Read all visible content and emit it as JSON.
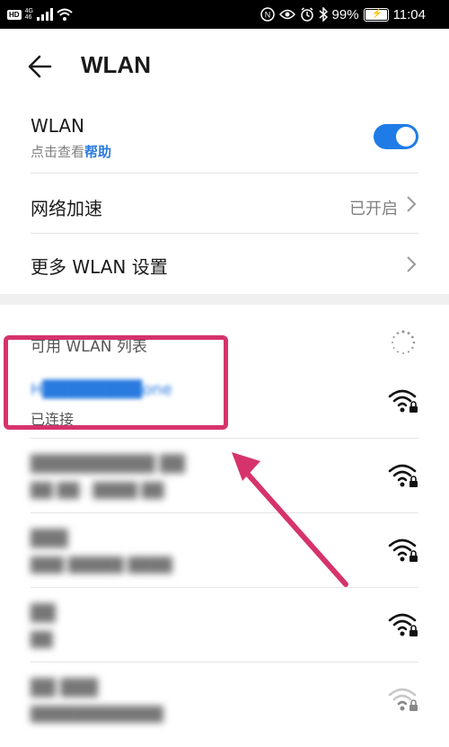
{
  "status_bar": {
    "hd": "HD",
    "network_type_top": "4G",
    "network_type_bottom": "46",
    "battery_percent": "99%",
    "time": "11:04",
    "icons": [
      "signal-icon",
      "wifi-icon",
      "nfc-icon",
      "eye-icon",
      "alarm-icon",
      "bluetooth-icon",
      "battery-icon"
    ]
  },
  "header": {
    "title": "WLAN",
    "back_icon": "arrow-left-icon"
  },
  "wlan_toggle": {
    "label": "WLAN",
    "sub_prefix": "点击查看",
    "help_link": "帮助",
    "enabled": true,
    "accent": "#1f7ce6"
  },
  "network_acceleration": {
    "label": "网络加速",
    "value": "已开启"
  },
  "more_settings": {
    "label": "更多 WLAN 设置"
  },
  "available_list": {
    "header": "可用 WLAN 列表",
    "networks": [
      {
        "name": "H████████one",
        "status": "已连接",
        "connected": true,
        "secured": true,
        "signal": "full"
      },
      {
        "name": "██████████ ██",
        "status": "██ ██ · ████ ██",
        "secured": true,
        "signal": "full"
      },
      {
        "name": "███",
        "status": "███ █████ ████",
        "secured": true,
        "signal": "full"
      },
      {
        "name": "██",
        "status": "██",
        "secured": true,
        "signal": "full"
      },
      {
        "name": "██ ███",
        "status": "████████████",
        "secured": true,
        "signal": "weak"
      }
    ]
  },
  "annotation": {
    "color": "#d6336c"
  }
}
